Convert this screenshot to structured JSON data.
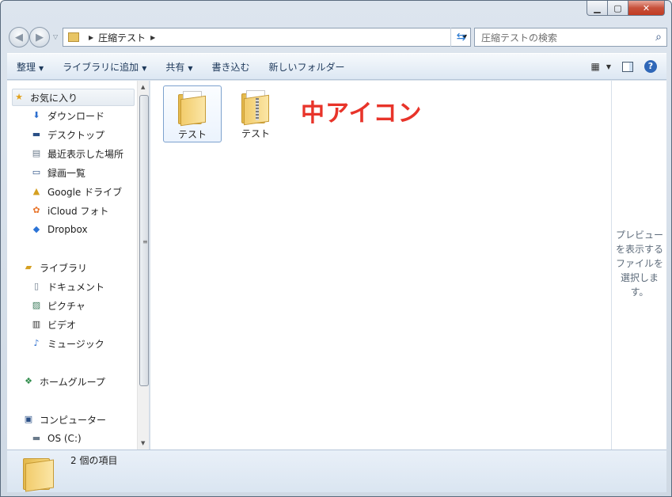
{
  "address": {
    "path": "圧縮テスト",
    "search_placeholder": "圧縮テストの検索"
  },
  "toolbar": {
    "organize": "整理",
    "add_to_library": "ライブラリに追加",
    "share": "共有",
    "burn": "書き込む",
    "new_folder": "新しいフォルダー"
  },
  "nav": {
    "favorites": "お気に入り",
    "downloads": "ダウンロード",
    "desktop": "デスクトップ",
    "recent": "最近表示した場所",
    "recordings": "録画一覧",
    "google_drive": "Google ドライブ",
    "icloud": "iCloud フォト",
    "dropbox": "Dropbox",
    "libraries": "ライブラリ",
    "documents": "ドキュメント",
    "pictures": "ピクチャ",
    "videos": "ビデオ",
    "music": "ミュージック",
    "homegroup": "ホームグループ",
    "computer": "コンピューター",
    "os_drive": "OS (C:)"
  },
  "files": [
    {
      "name": "テスト",
      "type": "folder",
      "selected": true
    },
    {
      "name": "テスト",
      "type": "zip-folder",
      "selected": false
    }
  ],
  "annotation": "中アイコン",
  "preview_text": "プレビューを表示するファイルを選択します。",
  "details": {
    "count": "2 個の項目"
  },
  "colors": {
    "annotation": "#e8342a",
    "toolbar_text": "#1e395b"
  }
}
